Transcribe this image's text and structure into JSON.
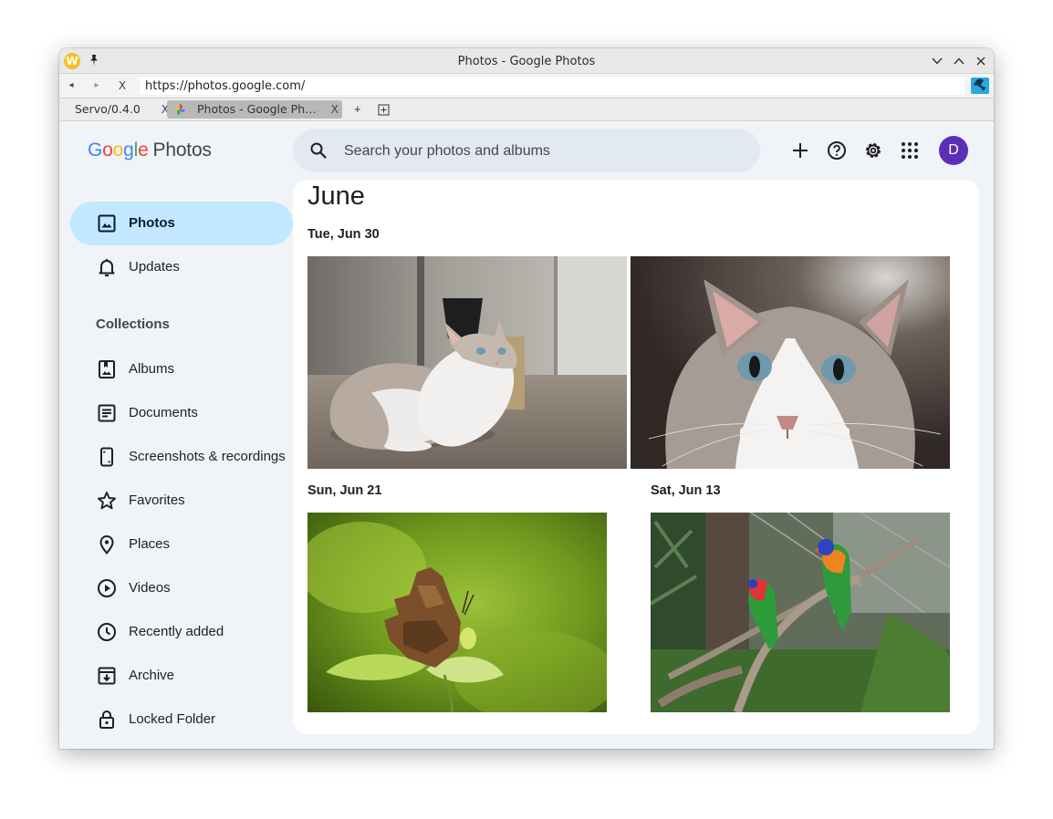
{
  "window": {
    "title": "Photos - Google Photos",
    "url": "https://photos.google.com/"
  },
  "nav": {
    "back": "◂",
    "forward": "▸",
    "stop": "X"
  },
  "tabs": [
    {
      "label": "Servo/0.4.0",
      "close": "X"
    },
    {
      "label": "Photos - Google Photos",
      "close": "X"
    }
  ],
  "tab_tools": {
    "new_tab": "+"
  },
  "header": {
    "logo_google": [
      "G",
      "o",
      "o",
      "g",
      "l",
      "e"
    ],
    "logo_colors": [
      "#4285f4",
      "#ea4335",
      "#fbbc04",
      "#4285f4",
      "#34a853",
      "#ea4335"
    ],
    "logo_product": "Photos",
    "search_placeholder": "Search your photos and albums",
    "avatar_initial": "D",
    "avatar_color": "#5b2fb5"
  },
  "sidebar": {
    "primary": [
      {
        "label": "Photos",
        "icon": "photo-icon",
        "active": true
      },
      {
        "label": "Updates",
        "icon": "bell-icon"
      }
    ],
    "collections_title": "Collections",
    "collections": [
      {
        "label": "Albums",
        "icon": "album-icon"
      },
      {
        "label": "Documents",
        "icon": "document-icon"
      },
      {
        "label": "Screenshots & recordings",
        "icon": "phone-screenshot-icon"
      },
      {
        "label": "Favorites",
        "icon": "star-icon"
      },
      {
        "label": "Places",
        "icon": "pin-icon"
      },
      {
        "label": "Videos",
        "icon": "play-icon"
      },
      {
        "label": "Recently added",
        "icon": "clock-icon"
      },
      {
        "label": "Archive",
        "icon": "archive-icon"
      },
      {
        "label": "Locked Folder",
        "icon": "lock-icon"
      }
    ]
  },
  "main": {
    "month": "June",
    "groups": [
      {
        "date": "Tue, Jun 30",
        "photos": [
          "cat-lying-on-carpet",
          "cat-face-closeup"
        ]
      },
      {
        "date": "Sun, Jun 21",
        "photos": [
          "butterfly-on-leaf"
        ]
      },
      {
        "date": "Sat, Jun 13",
        "photos": [
          "lorikeets-on-branch"
        ]
      }
    ]
  },
  "colors": {
    "accent_active": "#c2e7ff",
    "page_bg": "#f0f4f9"
  }
}
